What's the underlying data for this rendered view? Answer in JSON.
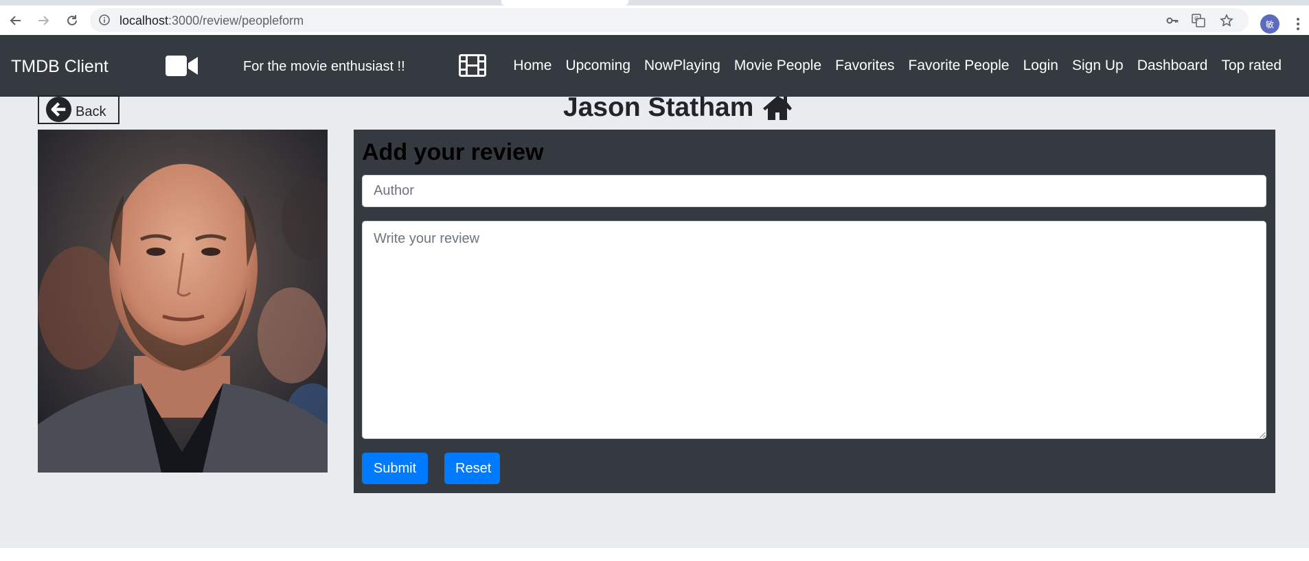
{
  "browser": {
    "url_host": "localhost",
    "url_path": ":3000/review/peopleform",
    "avatar_text": "敏"
  },
  "navbar": {
    "brand": "TMDB Client",
    "tagline": "For the movie enthusiast !!",
    "links": [
      {
        "label": "Home"
      },
      {
        "label": "Upcoming"
      },
      {
        "label": "NowPlaying"
      },
      {
        "label": "Movie People"
      },
      {
        "label": "Favorites"
      },
      {
        "label": "Favorite People"
      },
      {
        "label": "Login"
      },
      {
        "label": "Sign Up"
      },
      {
        "label": "Dashboard"
      },
      {
        "label": "Top rated"
      }
    ]
  },
  "page": {
    "back_label": "Back",
    "title": "Jason Statham"
  },
  "review_form": {
    "heading": "Add your review",
    "author_placeholder": "Author",
    "review_placeholder": "Write your review",
    "submit_label": "Submit",
    "reset_label": "Reset"
  },
  "colors": {
    "navbar_bg": "#343a40",
    "page_bg": "#e9ecef",
    "button_primary": "#007bff"
  }
}
